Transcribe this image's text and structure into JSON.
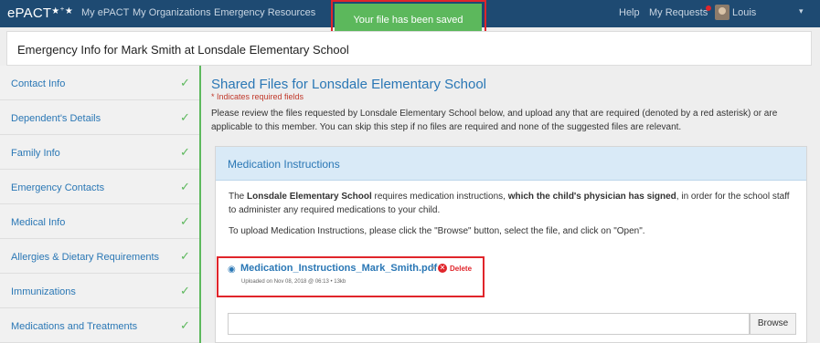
{
  "nav": {
    "logo": "ePACT",
    "logo_stars": "★⁺★",
    "links": [
      "My ePACT",
      "My Organizations",
      "Emergency Resources"
    ],
    "help": "Help",
    "my_requests": "My Requests",
    "user": "Louis",
    "caret": "▾",
    "notification_color": "#e0252b"
  },
  "toast": {
    "message": "Your file has been saved",
    "color": "#5cb85c"
  },
  "page_header": {
    "title": "Emergency Info for Mark Smith at Lonsdale Elementary School"
  },
  "sidebar": {
    "items": [
      {
        "label": "Contact Info",
        "check": "✓"
      },
      {
        "label": "Dependent's Details",
        "check": "✓"
      },
      {
        "label": "Family Info",
        "check": "✓"
      },
      {
        "label": "Emergency Contacts",
        "check": "✓"
      },
      {
        "label": "Medical Info",
        "check": "✓"
      },
      {
        "label": "Allergies & Dietary Requirements",
        "check": "✓"
      },
      {
        "label": "Immunizations",
        "check": "✓"
      },
      {
        "label": "Medications and Treatments",
        "check": "✓"
      }
    ]
  },
  "main": {
    "title": "Shared Files for Lonsdale Elementary School",
    "required_note": "* Indicates required fields",
    "intro": "Please review the files requested by Lonsdale Elementary School below, and upload any that are required (denoted by a red asterisk) or are applicable to this member. You can skip this step if no files are required and none of the suggested files are relevant."
  },
  "panel": {
    "title": "Medication Instructions",
    "p1_a": "The ",
    "p1_school": "Lonsdale Elementary School",
    "p1_b": " requires medication instructions, ",
    "p1_bold": "which the child's physician has signed",
    "p1_c": ", in order for the school staff to administer any required medications to your child.",
    "p2": "To upload Medication Instructions, please click the \"Browse\" button, select the file, and click on \"Open\".",
    "file": {
      "name": "Medication_Instructions_Mark_Smith.pdf",
      "separator": "•",
      "delete_label": "Delete",
      "delete_glyph": "✕",
      "eye_glyph": "◉",
      "meta": "Uploaded on Nov 08, 2018 @ 06:13  •  13kb"
    },
    "upload_value": "",
    "browse_label": "Browse"
  }
}
